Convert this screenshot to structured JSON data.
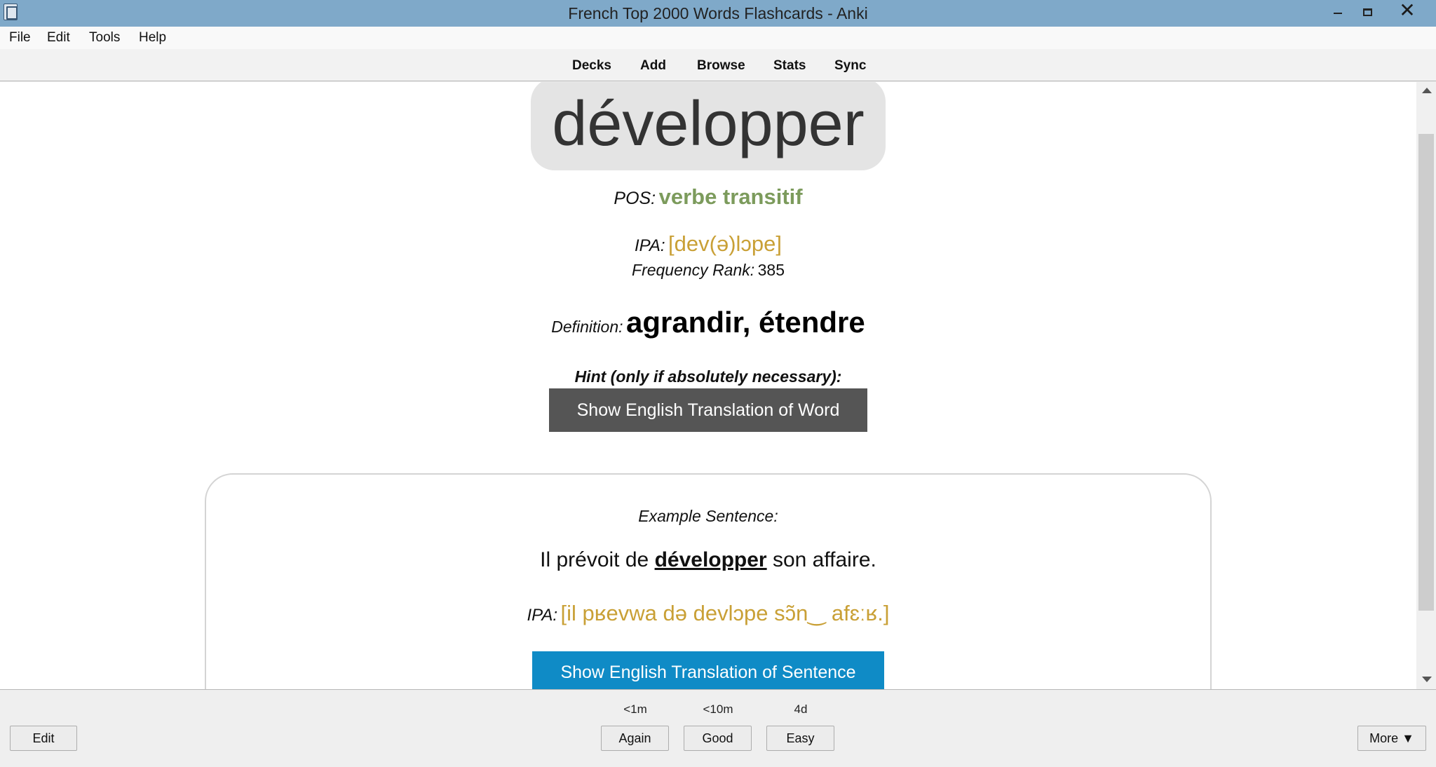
{
  "window": {
    "title": "French Top 2000 Words Flashcards - Anki"
  },
  "menu": {
    "items": [
      {
        "label": "File"
      },
      {
        "label": "Edit"
      },
      {
        "label": "Tools"
      },
      {
        "label": "Help"
      }
    ]
  },
  "toolbar": {
    "items": [
      {
        "label": "Decks"
      },
      {
        "label": "Add"
      },
      {
        "label": "Browse"
      },
      {
        "label": "Stats"
      },
      {
        "label": "Sync"
      }
    ]
  },
  "card": {
    "word": "développer",
    "pos_label": "POS:",
    "pos_value": "verbe transitif",
    "ipa_label": "IPA:",
    "ipa_value": "[dev(ə)lɔpe]",
    "rank_label": "Frequency Rank:",
    "rank_value": "385",
    "definition_label": "Definition:",
    "definition_value": "agrandir, étendre",
    "hint_label": "Hint (only if absolutely necessary):",
    "hint_button": "Show English Translation of Word",
    "example_label": "Example Sentence:",
    "sentence_before": "Il prévoit de ",
    "sentence_target": "développer",
    "sentence_after": " son affaire.",
    "sentence_ipa_label": "IPA:",
    "sentence_ipa_value": "[il pʁevwa də devlɔpe sɔ̃n‿ afɛːʁ.]",
    "sentence_button": "Show English Translation of Sentence"
  },
  "answer_bar": {
    "edit_label": "Edit",
    "more_label": "More ▼",
    "buttons": [
      {
        "label": "Again",
        "interval": "<1m"
      },
      {
        "label": "Good",
        "interval": "<10m"
      },
      {
        "label": "Easy",
        "interval": "4d"
      }
    ]
  },
  "colors": {
    "titlebar": "#7fa9c9",
    "pos": "#7c9b5c",
    "ipa": "#c9a036",
    "hint_button": "#555555",
    "sentence_button": "#0f8bc6"
  }
}
